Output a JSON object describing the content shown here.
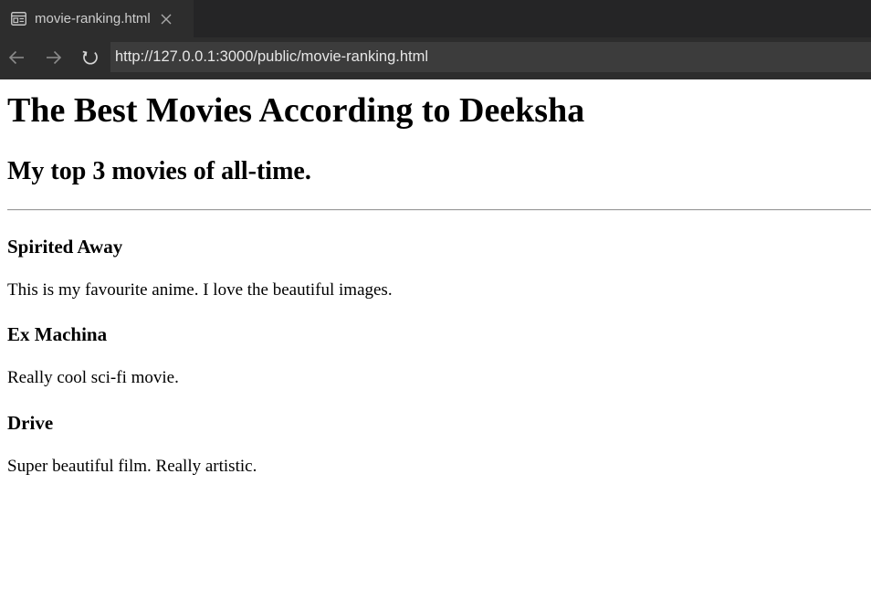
{
  "browser": {
    "tab": {
      "title": "movie-ranking.html",
      "icon": "page-icon",
      "close_icon": "close-icon"
    },
    "nav": {
      "back_icon": "arrow-left-icon",
      "forward_icon": "arrow-right-icon",
      "reload_icon": "reload-icon",
      "url": "http://127.0.0.1:3000/public/movie-ranking.html"
    },
    "colors": {
      "chrome_bg": "#252526",
      "tab_bg": "#2d2d2d",
      "address_bg": "#3c3c3c",
      "chrome_text": "#cccccc"
    }
  },
  "page": {
    "heading": "The Best Movies According to Deeksha",
    "subheading": "My top 3 movies of all-time.",
    "movies": [
      {
        "title": "Spirited Away",
        "description": "This is my favourite anime. I love the beautiful images."
      },
      {
        "title": "Ex Machina",
        "description": "Really cool sci-fi movie."
      },
      {
        "title": "Drive",
        "description": "Super beautiful film. Really artistic."
      }
    ]
  }
}
